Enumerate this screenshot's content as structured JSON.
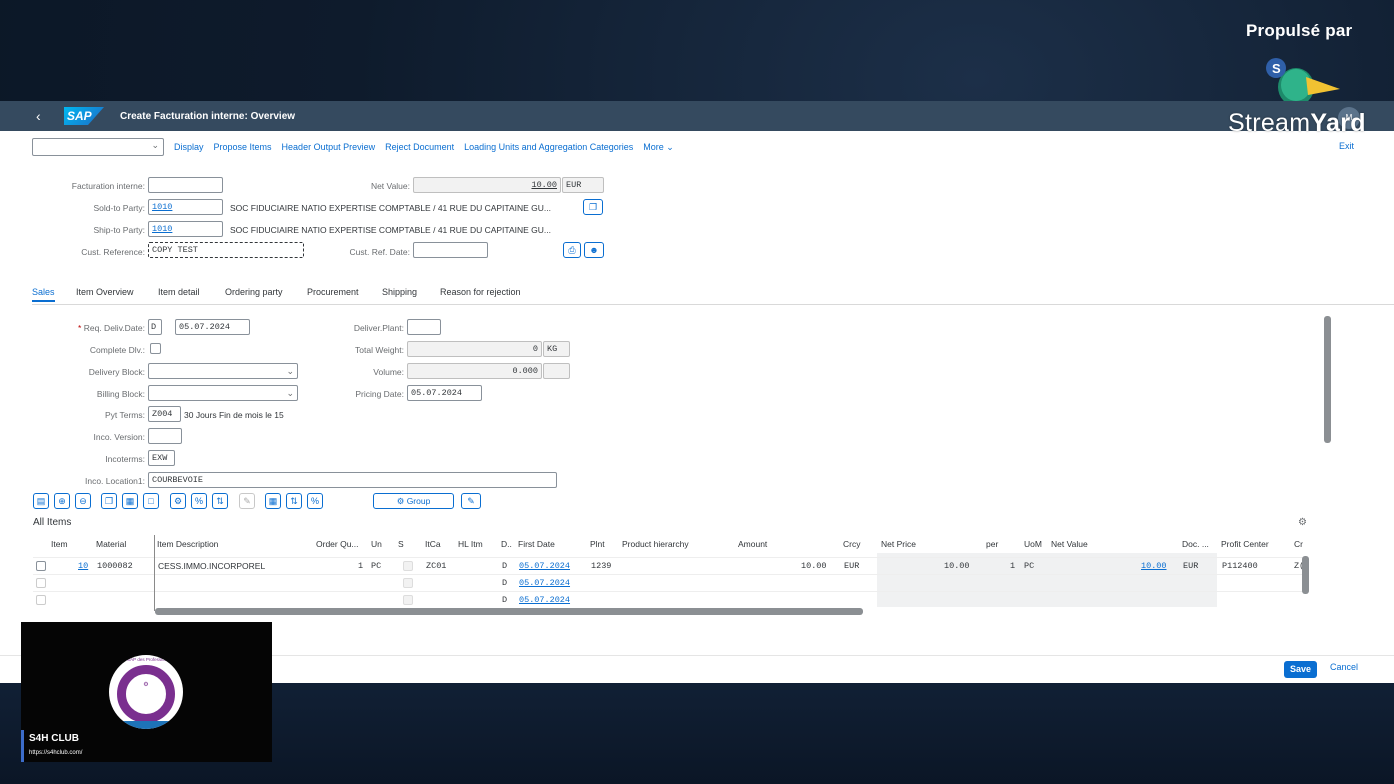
{
  "overlay": {
    "propulse": "Propulsé par",
    "stream_brand_light": "Stream",
    "stream_brand_bold": "Yard",
    "cam_name": "S4H CLUB",
    "cam_url": "https://s4hclub.com/",
    "cam_logo_text": "Club SAP des Professionnels"
  },
  "shell": {
    "title": "Create Facturation interne: Overview",
    "avatar": "M",
    "logo": "SAP"
  },
  "toolbar": {
    "select_value": "",
    "actions": [
      "Display",
      "Propose Items",
      "Header Output Preview",
      "Reject Document",
      "Loading Units and Aggregation Categories",
      "More"
    ],
    "exit": "Exit"
  },
  "header": {
    "facturation_label": "Facturation interne:",
    "facturation_value": "",
    "net_value_label": "Net Value:",
    "net_value": "10.00",
    "currency": "EUR",
    "sold_to_label": "Sold-to Party:",
    "sold_to_value": "1010",
    "sold_to_desc": "SOC FIDUCIAIRE NATIO EXPERTISE COMPTABLE / 41 RUE DU CAPITAINE GU...",
    "ship_to_label": "Ship-to Party:",
    "ship_to_value": "1010",
    "ship_to_desc": "SOC FIDUCIAIRE NATIO EXPERTISE COMPTABLE / 41 RUE DU CAPITAINE GU...",
    "cust_ref_label": "Cust. Reference:",
    "cust_ref_value": "COPY TEST",
    "cust_ref_date_label": "Cust. Ref. Date:",
    "cust_ref_date_value": ""
  },
  "tabs": [
    "Sales",
    "Item Overview",
    "Item detail",
    "Ordering party",
    "Procurement",
    "Shipping",
    "Reason for rejection"
  ],
  "sales": {
    "req_deliv_label": "Req. Deliv.Date:",
    "req_deliv_type": "D",
    "req_deliv_date": "05.07.2024",
    "complete_dlv_label": "Complete Dlv.:",
    "delivery_block_label": "Delivery Block:",
    "billing_block_label": "Billing Block:",
    "pyt_terms_label": "Pyt Terms:",
    "pyt_terms_value": "Z004",
    "pyt_terms_desc": "30 Jours Fin de mois le 15",
    "inco_version_label": "Inco. Version:",
    "incoterms_label": "Incoterms:",
    "incoterms_value": "EXW",
    "inco_loc_label": "Inco. Location1:",
    "inco_loc_value": "COURBEVOIE",
    "deliver_plant_label": "Deliver.Plant:",
    "total_weight_label": "Total Weight:",
    "total_weight_value": "0",
    "weight_unit": "KG",
    "volume_label": "Volume:",
    "volume_value": "0.000",
    "pricing_date_label": "Pricing Date:",
    "pricing_date_value": "05.07.2024"
  },
  "items": {
    "title": "All Items",
    "group_label": "Group",
    "columns": [
      "Item",
      "Material",
      "Item Description",
      "Order Qu...",
      "Un",
      "S",
      "ItCa",
      "HL Itm",
      "D..",
      "First Date",
      "Plnt",
      "Product hierarchy",
      "Amount",
      "Crcy",
      "Net Price",
      "per",
      "UoM",
      "Net Value",
      "Doc. ...",
      "Profit Center",
      "Cr"
    ],
    "rows": [
      {
        "item": "10",
        "material": "1000082",
        "desc": "CESS.IMMO.INCORPOREL",
        "qty": "1",
        "un": "PC",
        "itca": "ZC01",
        "d": "D",
        "first_date": "05.07.2024",
        "plnt": "1239",
        "amount": "10.00",
        "crcy": "EUR",
        "net_price": "10.00",
        "per": "1",
        "uom": "PC",
        "net_value": "10.00",
        "doc": "EUR",
        "profit_center": "P112400",
        "cr": "Z("
      },
      {
        "d": "D",
        "first_date": "05.07.2024"
      },
      {
        "d": "D",
        "first_date": "05.07.2024"
      }
    ]
  },
  "footer": {
    "save": "Save",
    "cancel": "Cancel"
  }
}
